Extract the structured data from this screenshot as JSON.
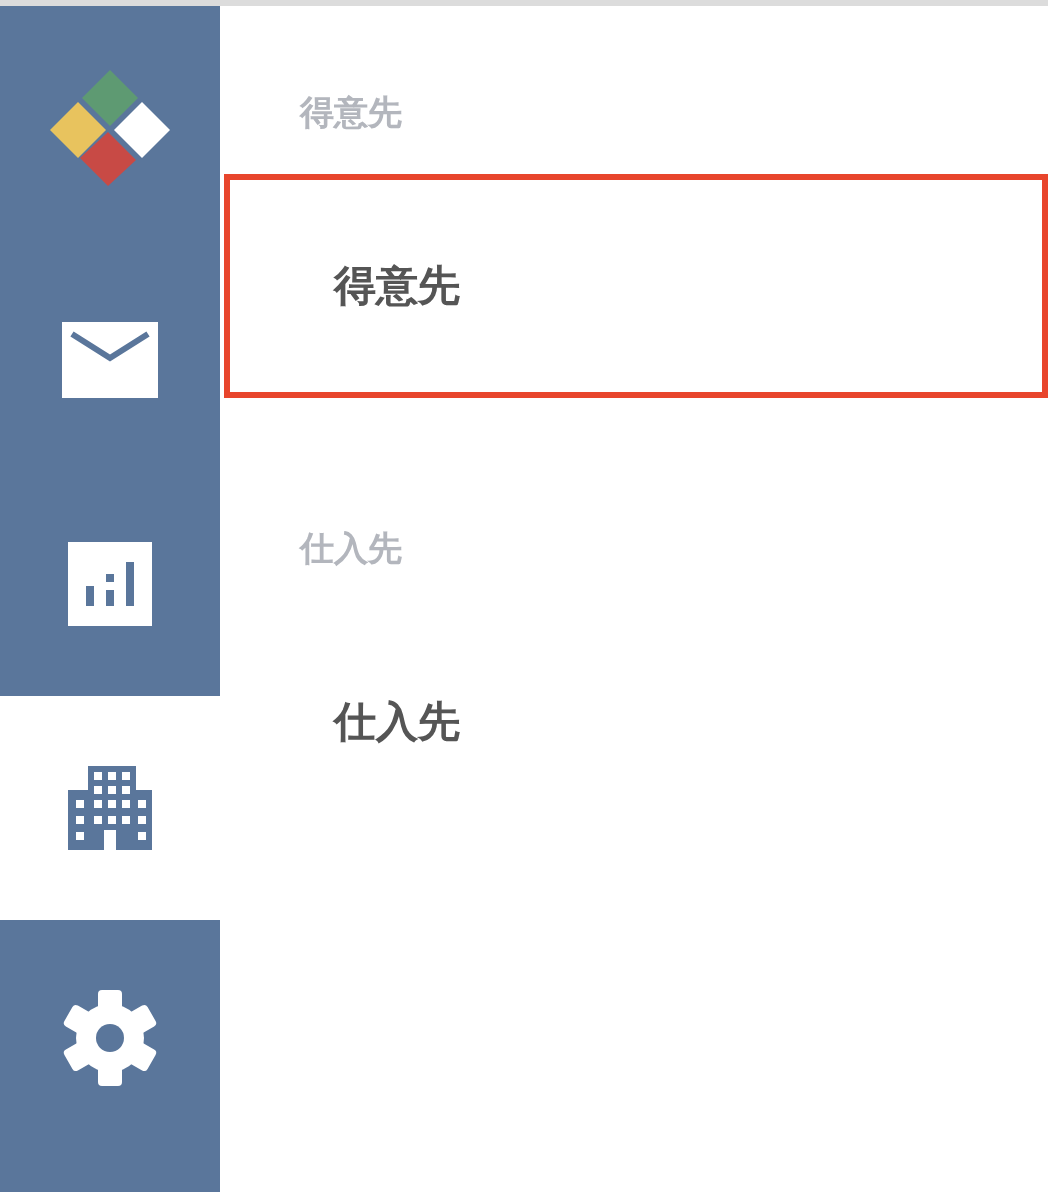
{
  "sidebar": {
    "items": [
      {
        "kind": "mail",
        "selected": false
      },
      {
        "kind": "chart",
        "selected": false
      },
      {
        "kind": "building",
        "selected": true
      },
      {
        "kind": "settings",
        "selected": false
      }
    ]
  },
  "sections": [
    {
      "heading": "得意先",
      "items": [
        {
          "label": "得意先",
          "selected": true
        }
      ]
    },
    {
      "heading": "仕入先",
      "items": [
        {
          "label": "仕入先",
          "selected": false
        }
      ]
    }
  ]
}
